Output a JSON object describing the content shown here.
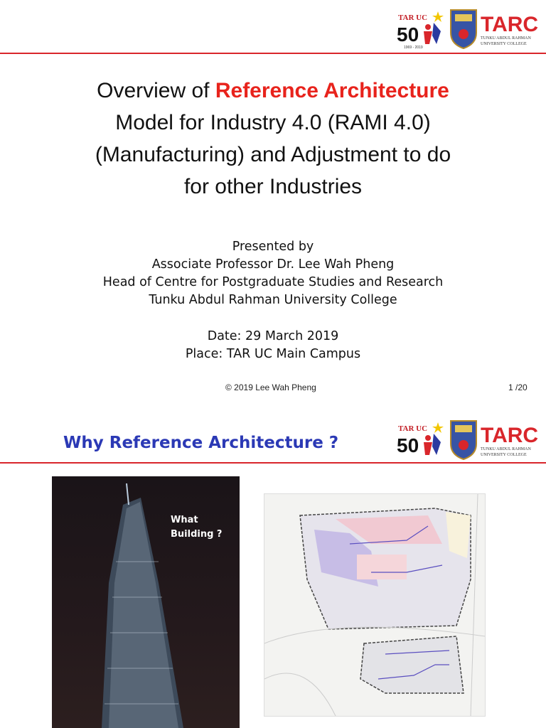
{
  "slide1": {
    "logo": {
      "anniversary_text": "TAR UC",
      "anniversary_number": "50",
      "anniversary_years": "1969 - 2019",
      "brand": "TARC",
      "brand_sub1": "TUNKU ABDUL RAHMAN",
      "brand_sub2": "UNIVERSITY COLLEGE"
    },
    "title_prefix": "Overview of ",
    "title_highlight": "Reference Architecture",
    "title_line2": "Model for Industry 4.0 (RAMI 4.0)",
    "title_line3": "(Manufacturing) and Adjustment to do",
    "title_line4": "for other Industries",
    "presented_by": "Presented by",
    "presenter": "Associate Professor Dr. Lee Wah Pheng",
    "position": "Head of Centre for Postgraduate Studies and Research",
    "institution": "Tunku Abdul Rahman University College",
    "date": "Date: 29 March 2019",
    "place": "Place:  TAR UC Main Campus",
    "copyright": "© 2019  Lee Wah Pheng",
    "page": "1 /20"
  },
  "slide2": {
    "title": "Why Reference Architecture ?",
    "photo_caption": "What Building ?",
    "colors": {
      "title": "#2b39b5",
      "accent": "#d9262b"
    }
  }
}
